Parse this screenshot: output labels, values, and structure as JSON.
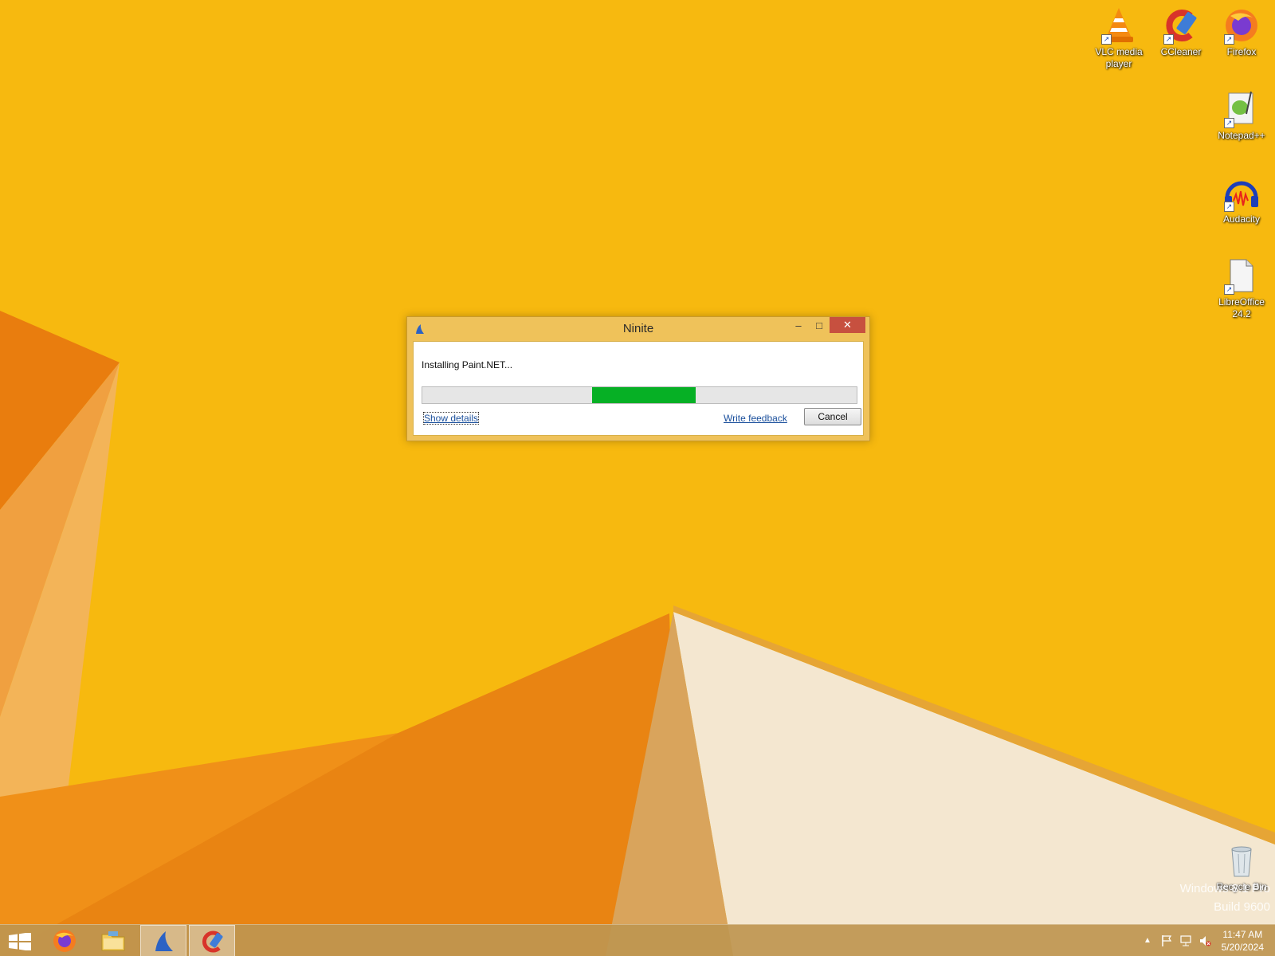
{
  "desktop": {
    "icons": [
      {
        "label": "VLC media player",
        "icon": "vlc-icon"
      },
      {
        "label": "CCleaner",
        "icon": "ccleaner-icon"
      },
      {
        "label": "Firefox",
        "icon": "firefox-icon"
      },
      {
        "label": "Notepad++",
        "icon": "notepadpp-icon"
      },
      {
        "label": "Audacity",
        "icon": "audacity-icon"
      },
      {
        "label": "LibreOffice 24.2",
        "icon": "libreoffice-icon"
      },
      {
        "label": "Recycle Bin",
        "icon": "recycle-bin-icon"
      }
    ],
    "watermark": {
      "line1": "Windows 8.1 Pro",
      "line2": "Build 9600"
    },
    "wallpaper_color": "#f6b811"
  },
  "window": {
    "title": "Ninite",
    "status": "Installing Paint.NET...",
    "progress": {
      "mode": "marquee",
      "chunk_start": 0.39,
      "chunk_end": 0.63,
      "color": "#06b025"
    },
    "show_details": "Show details",
    "write_feedback": "Write feedback",
    "cancel": "Cancel",
    "controls": {
      "minimize": "minimize-icon",
      "maximize": "maximize-icon",
      "close": "close-icon"
    }
  },
  "taskbar": {
    "items": [
      {
        "name": "start",
        "icon": "windows-logo-icon"
      },
      {
        "name": "firefox",
        "icon": "firefox-icon"
      },
      {
        "name": "file-explorer",
        "icon": "folder-icon"
      },
      {
        "name": "ninite",
        "icon": "ninite-icon",
        "active": true
      },
      {
        "name": "ccleaner",
        "icon": "ccleaner-icon"
      }
    ],
    "tray": {
      "icons": [
        "chevron-up-icon",
        "flag-icon",
        "network-icon",
        "volume-muted-icon"
      ],
      "time": "11:47 AM",
      "date": "5/20/2024"
    }
  }
}
